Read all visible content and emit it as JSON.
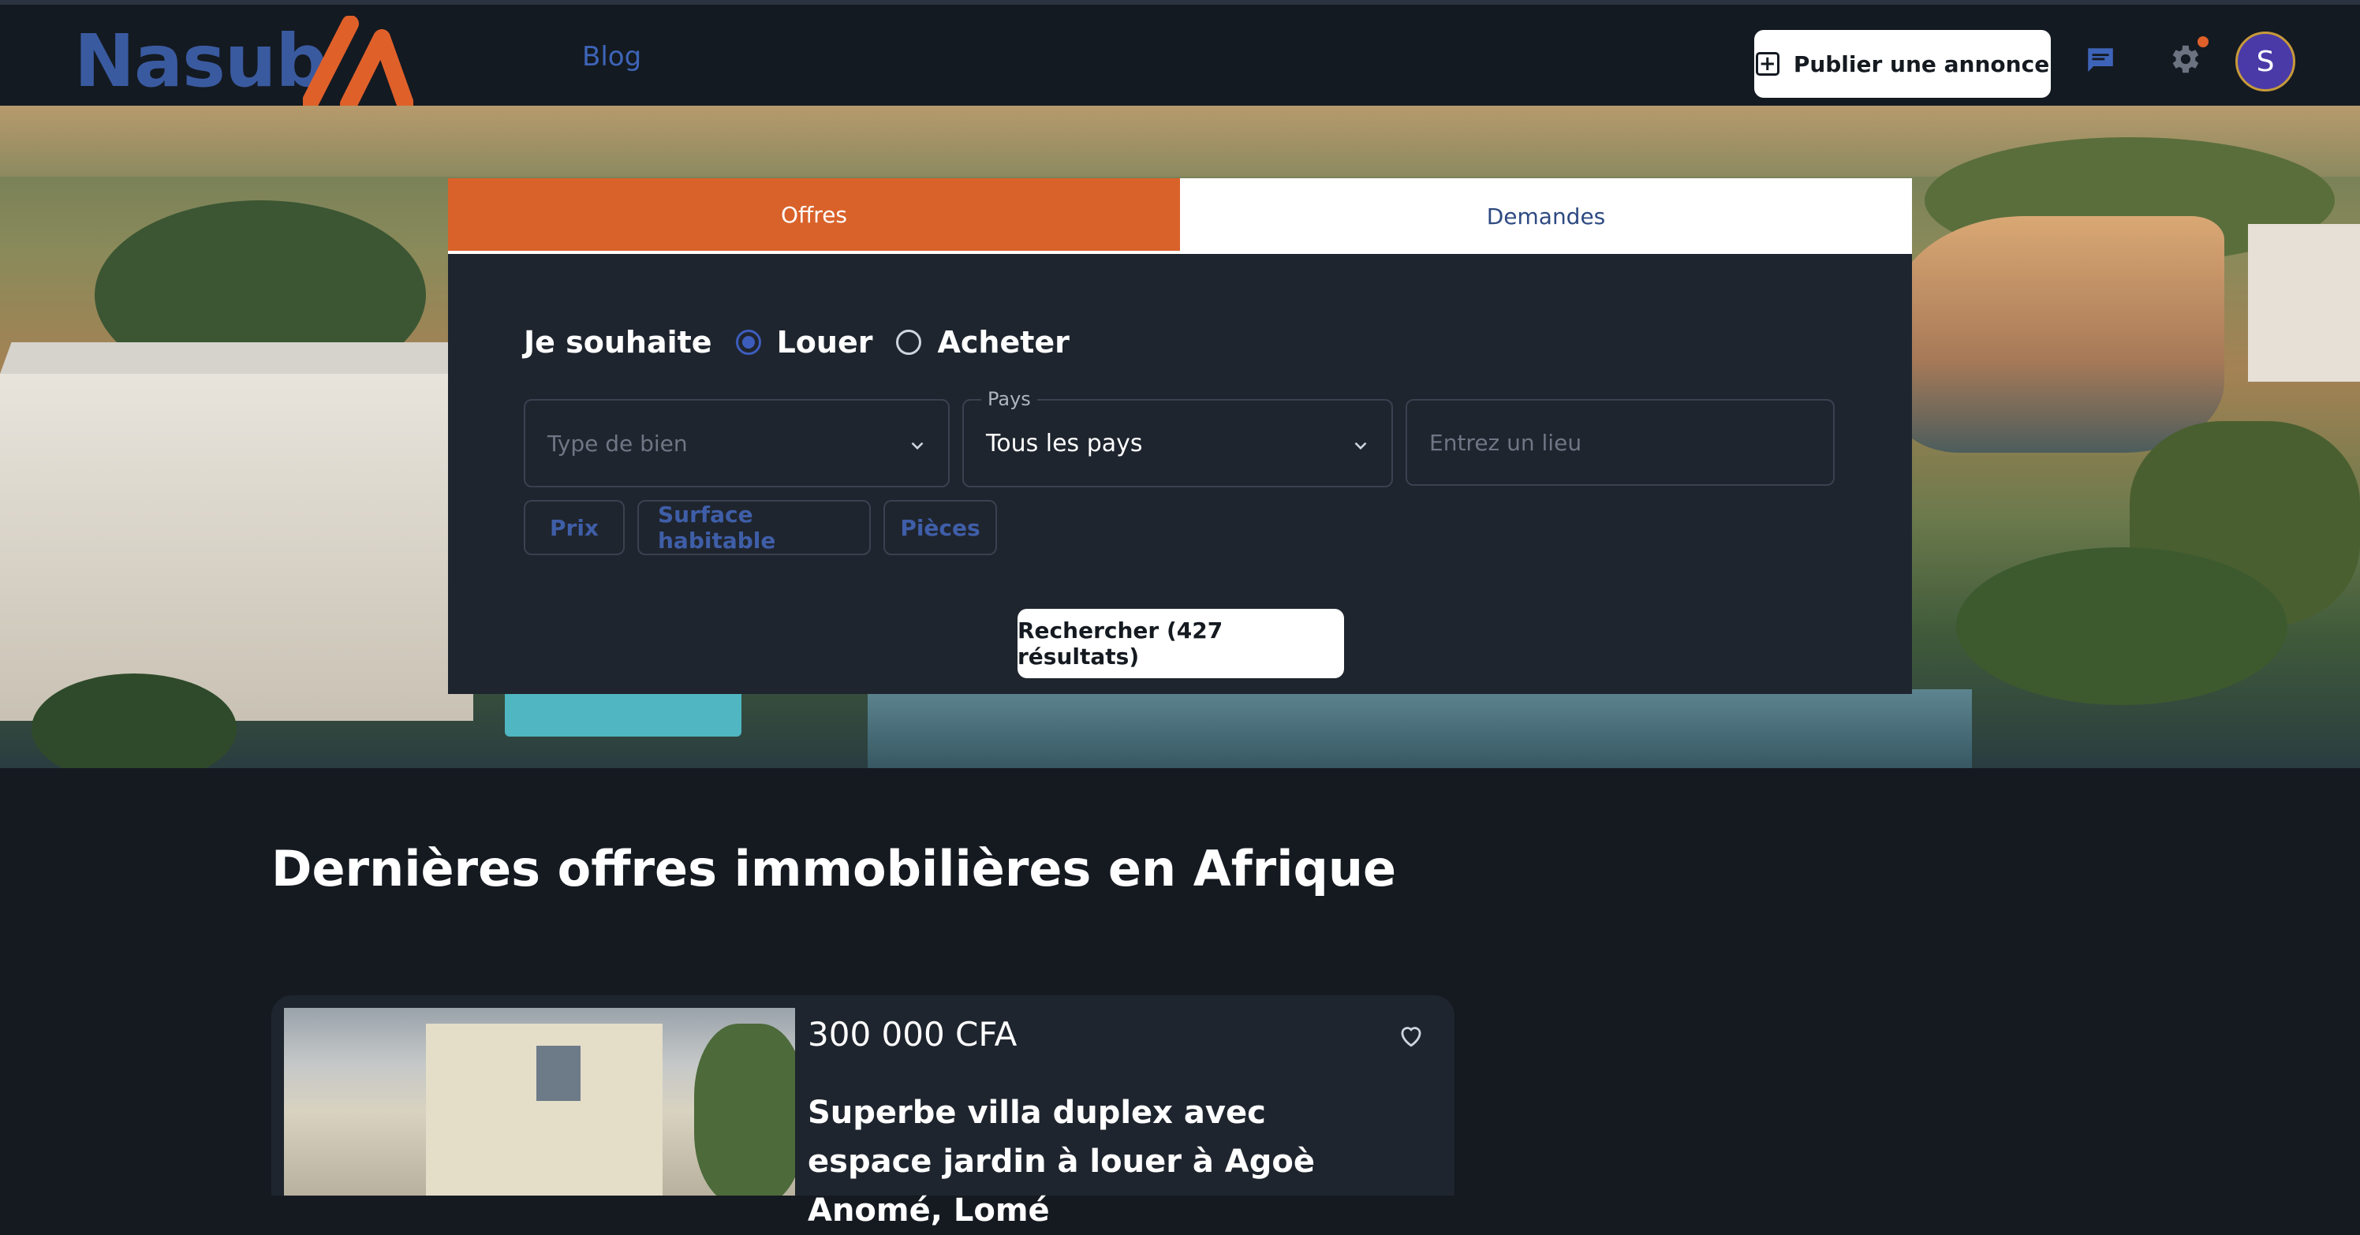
{
  "header": {
    "logo_text": "Nasub",
    "nav": {
      "blog": "Blog"
    },
    "publish_label": "Publier une annonce",
    "avatar_initial": "S",
    "icons": [
      "chat-icon",
      "gear-icon"
    ],
    "colors": {
      "brand_blue": "#3a5aa0",
      "accent_orange": "#d9622b"
    }
  },
  "search": {
    "tabs": [
      {
        "label": "Offres",
        "active": true
      },
      {
        "label": "Demandes",
        "active": false
      }
    ],
    "intent_label": "Je souhaite",
    "options": [
      {
        "label": "Louer",
        "checked": true
      },
      {
        "label": "Acheter",
        "checked": false
      }
    ],
    "property_type_placeholder": "Type de bien",
    "country_label": "Pays",
    "country_value": "Tous les pays",
    "location_placeholder": "Entrez un lieu",
    "filters": [
      "Prix",
      "Surface habitable",
      "Pièces"
    ],
    "submit_label": "Rechercher (427 résultats)"
  },
  "listings": {
    "title": "Dernières offres immobilières en Afrique",
    "items": [
      {
        "price": "300 000 CFA",
        "title": "Superbe villa duplex avec espace jardin à louer à Agoè Anomé, Lomé"
      }
    ]
  }
}
